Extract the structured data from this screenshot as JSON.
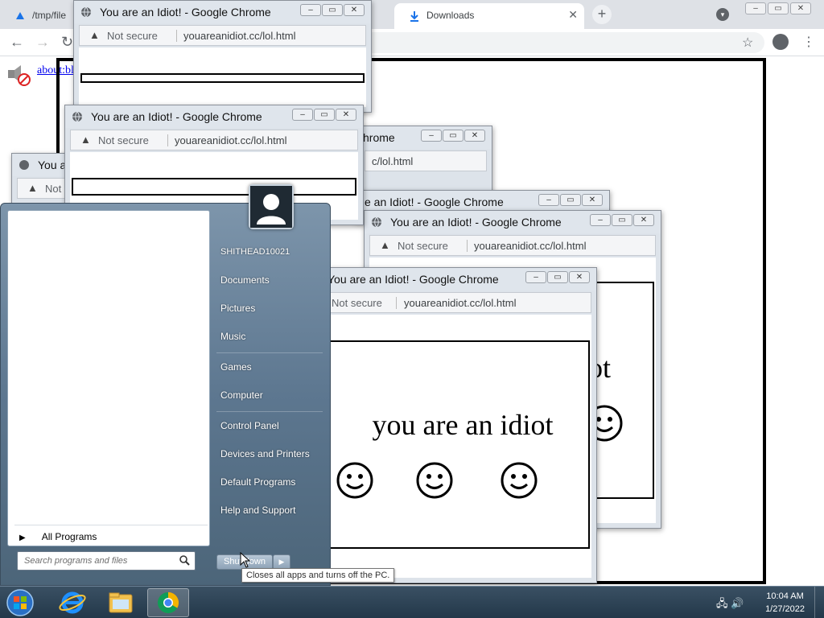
{
  "background_browser": {
    "tabs": [
      {
        "label": "/tmp/file",
        "icon": "google-drive-icon"
      },
      {
        "label": "Downloads",
        "icon": "download-icon"
      }
    ],
    "page_link": "about:bl",
    "window_controls": [
      "–",
      "▭",
      "✕"
    ]
  },
  "popup": {
    "title": "You are an Idiot! - Google Chrome",
    "title_partial_you": "You a",
    "title_partial_hrome": "hrome",
    "title_partial_idiot": "e an Idiot! - Google Chrome",
    "not_secure": "Not secure",
    "not_secure_partial": "Not",
    "url": "youareanidiot.cc/lol.html",
    "url_partial": "c/lol.html",
    "message": "you are an idiot",
    "message_partial": "ot",
    "smiley": "☺",
    "controls": [
      "–",
      "▭",
      "✕"
    ]
  },
  "start_menu": {
    "username": "SHITHEAD10021",
    "items": [
      "Documents",
      "Pictures",
      "Music",
      "Games",
      "Computer",
      "Control Panel",
      "Devices and Printers",
      "Default Programs",
      "Help and Support"
    ],
    "all_programs": "All Programs",
    "search_placeholder": "Search programs and files",
    "shutdown_label": "Shut down",
    "shutdown_tooltip": "Closes all apps and turns off the PC."
  },
  "taskbar": {
    "pinned": [
      {
        "name": "internet-explorer-icon"
      },
      {
        "name": "windows-explorer-icon"
      },
      {
        "name": "chrome-icon"
      }
    ],
    "time": "10:04 AM",
    "date": "1/27/2022"
  },
  "colors": {
    "taskbar": "#23384a",
    "start_menu": "#5d7790",
    "link": "#0000ee"
  }
}
